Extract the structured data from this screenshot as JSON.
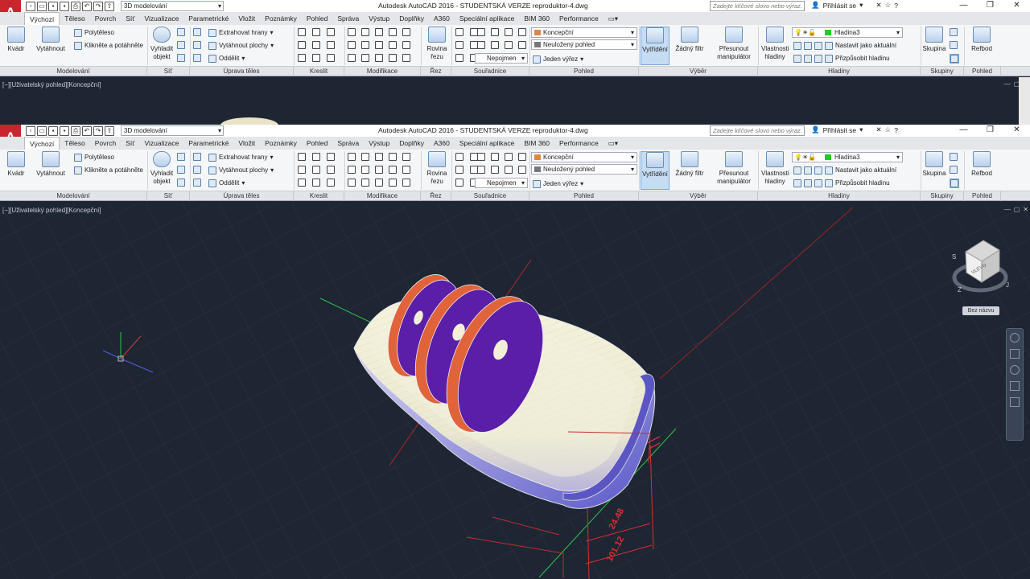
{
  "app": {
    "title": "Autodesk AutoCAD 2016 - STUDENTSKÁ VERZE   reproduktor-4.dwg",
    "logo": "A",
    "workspace": "3D modelování",
    "search_placeholder": "Zadejte klíčové slovo nebo výraz.",
    "signin": "Přihlásit se"
  },
  "tabs": [
    "Výchozí",
    "Těleso",
    "Povrch",
    "Síť",
    "Vizualizace",
    "Parametrické",
    "Vložit",
    "Poznámky",
    "Pohled",
    "Správa",
    "Výstup",
    "Doplňky",
    "A360",
    "Speciální aplikace",
    "BIM 360",
    "Performance"
  ],
  "ribbon": {
    "kvadr": "Kvádr",
    "vytahnout": "Vytáhnout",
    "polyteleso": "Polytěleso",
    "kliknete": "Klikněte a potáhněte",
    "vyhladit1": "Vyhladit",
    "vyhladit2": "objekt",
    "extrahovat": "Extrahovat hrany",
    "vytahnout_plochy": "Vytáhnout plochy",
    "oddelit": "Oddělit",
    "rovina1": "Rovina",
    "rovina2": "řezu",
    "nepojmen": "Nepojmen",
    "visual_style": "Koncepční",
    "view": "Neuložený pohled",
    "viewport": "Jeden výřez",
    "vytrideni": "Vytřídění",
    "zadny_filtr": "Žádný filtr",
    "presunout1": "Přesunout",
    "presunout2": "manipulátor",
    "vlastnosti1": "Vlastnosti",
    "vlastnosti2": "hladiny",
    "layer": "Hladina3",
    "nastavit": "Nastavit jako aktuální",
    "prizpusobit": "Přizpůsobit hladinu",
    "skupina": "Skupina",
    "refbod": "Refbod"
  },
  "panels": [
    "Modelování",
    "Síť",
    "Úprava těles",
    "Kreslit",
    "Modifikace",
    "Řez",
    "Souřadnice",
    "Pohled",
    "Výběr",
    "Hladiny",
    "Skupiny",
    "Pohled"
  ],
  "viewport": {
    "label": "[−][Uživatelský pohled][Koncepční]",
    "viewcube_label": "Bez názvu",
    "compass_s": "S",
    "compass_j": "J",
    "compass_z": "Z",
    "cube_face": "VLEVO",
    "dim1": "24.48",
    "dim2": "101.12"
  },
  "colors": {
    "bg": "#1e2533",
    "accent_purple": "#5a1ea8",
    "accent_orange": "#e0633a",
    "shell": "#f3f2d8"
  }
}
